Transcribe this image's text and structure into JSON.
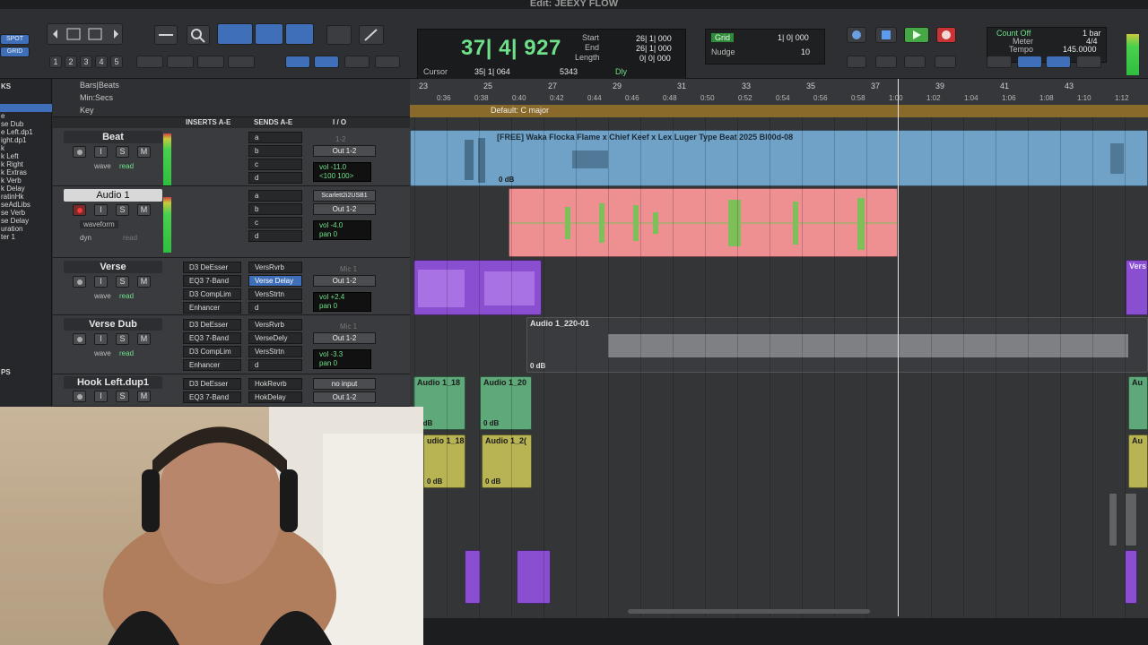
{
  "window": {
    "title": "Edit: JEEXY FLOW"
  },
  "toolbar": {
    "spot_label": "SPOT",
    "grid_mode": "GRID",
    "zoom_presets": [
      "1",
      "2",
      "3",
      "4",
      "5"
    ],
    "counter_main": "37| 4| 927",
    "start_label": "Start",
    "end_label": "End",
    "length_label": "Length",
    "start_value": "26| 1| 000",
    "end_value": "26| 1| 000",
    "length_value": "0| 0| 000",
    "cursor_label": "Cursor",
    "cursor_value": "35| 1| 064",
    "cursor_sample": "5343",
    "dly_label": "Dly",
    "grid_label": "Grid",
    "grid_value": "1| 0| 000",
    "nudge_label": "Nudge",
    "nudge_value": "10",
    "count_off": "Count Off",
    "meter_label": "Meter",
    "tempo_label": "Tempo",
    "bar_value": "1 bar",
    "meter_value": "4/4",
    "tempo_value": "145.0000"
  },
  "sidebar": {
    "header": "KS",
    "items": [
      "",
      "e",
      "se Dub",
      "e Left.dp1",
      "ight.dp1",
      "k",
      "k Left",
      "k Right",
      "k Extras",
      "k Verb",
      "k Delay",
      "ratinHk",
      "seAdLibs",
      "se Verb",
      "se Delay",
      "uration",
      "ter 1"
    ],
    "groups_header": "PS"
  },
  "rulers": {
    "bars_beats": "Bars|Beats",
    "min_secs": "Min:Secs",
    "key": "Key",
    "key_value": "Default: C major"
  },
  "columns": {
    "inserts": "INSERTS A-E",
    "sends": "SENDS A-E",
    "io": "I / O"
  },
  "bar_numbers": [
    "23",
    "25",
    "27",
    "29",
    "31",
    "33",
    "35",
    "37",
    "39",
    "41",
    "43"
  ],
  "time_marks": [
    "0:36",
    "0:38",
    "0:40",
    "0:42",
    "0:44",
    "0:46",
    "0:48",
    "0:50",
    "0:52",
    "0:54",
    "0:56",
    "0:58",
    "1:00",
    "1:02",
    "1:04",
    "1:06",
    "1:08",
    "1:10",
    "1:12"
  ],
  "tracks": [
    {
      "name": "Beat",
      "inserts": [
        "",
        "",
        "",
        ""
      ],
      "sends": [
        "a",
        "b",
        "c",
        "d"
      ],
      "io_out": "Out 1-2",
      "io_in": "1-2",
      "vol": "-11.0",
      "pan": "<100  100>",
      "mode": "wave",
      "state": "read"
    },
    {
      "name": "Audio 1",
      "inserts": [
        "",
        "",
        "",
        ""
      ],
      "sends": [
        "a",
        "b",
        "c",
        "d"
      ],
      "io_out": "Out 1-2",
      "io_in": "Scarlett2i2USB1",
      "vol": "-4.0",
      "pan": "0",
      "mode": "waveform",
      "state": "read",
      "extra": "dyn"
    },
    {
      "name": "Verse",
      "inserts": [
        "D3 DeEsser",
        "EQ3 7-Band",
        "D3 CompLim",
        "Enhancer"
      ],
      "sends": [
        "VersRvrb",
        "Verse Delay",
        "VersStrtn",
        "d"
      ],
      "io_out": "Out 1-2",
      "io_in": "Mic 1",
      "vol": "+2.4",
      "pan": "0",
      "mode": "wave",
      "state": "read"
    },
    {
      "name": "Verse Dub",
      "inserts": [
        "D3 DeEsser",
        "EQ3 7-Band",
        "D3 CompLim",
        "Enhancer"
      ],
      "sends": [
        "VersRvrb",
        "VerseDely",
        "VersStrtn",
        "d"
      ],
      "io_out": "Out 1-2",
      "io_in": "Mic 1",
      "vol": "-3.3",
      "pan": "0",
      "mode": "wave",
      "state": "read"
    },
    {
      "name": "Hook Left.dup1",
      "inserts": [
        "D3 DeEsser",
        "EQ3 7-Band"
      ],
      "sends": [
        "HokRevrb",
        "HokDelay"
      ],
      "io_out": "Out 1-2",
      "io_in": "no input",
      "vol": "",
      "pan": "",
      "mode": "",
      "state": ""
    }
  ],
  "clips": {
    "beat": {
      "name": "[FREE] Waka Flocka Flame x Chief Keef x Lex Luger Type Beat 2025 Bl00d-08",
      "db": "0 dB"
    },
    "verse_dub": {
      "name": "Audio 1_220-01",
      "db": "0 dB"
    },
    "hook1": {
      "name": "Audio 1_18",
      "db": "0 dB"
    },
    "hook2": {
      "name": "Audio 1_20",
      "db": "0 dB"
    },
    "hook3": {
      "name": "udio 1_18(",
      "db": "0 dB"
    },
    "hook4": {
      "name": "Audio 1_2(",
      "db": "0 dB"
    },
    "right_edge": {
      "name": "Vers"
    },
    "right_au1": "Au",
    "right_au2": "Au"
  },
  "colors": {
    "beat": "#6fa2c6",
    "audio1": "#ee8f92",
    "verse": "#8a4fd0",
    "verse_dub": "#8d8f93",
    "hook": "#5ea87a",
    "hook_dup": "#b8b453"
  }
}
